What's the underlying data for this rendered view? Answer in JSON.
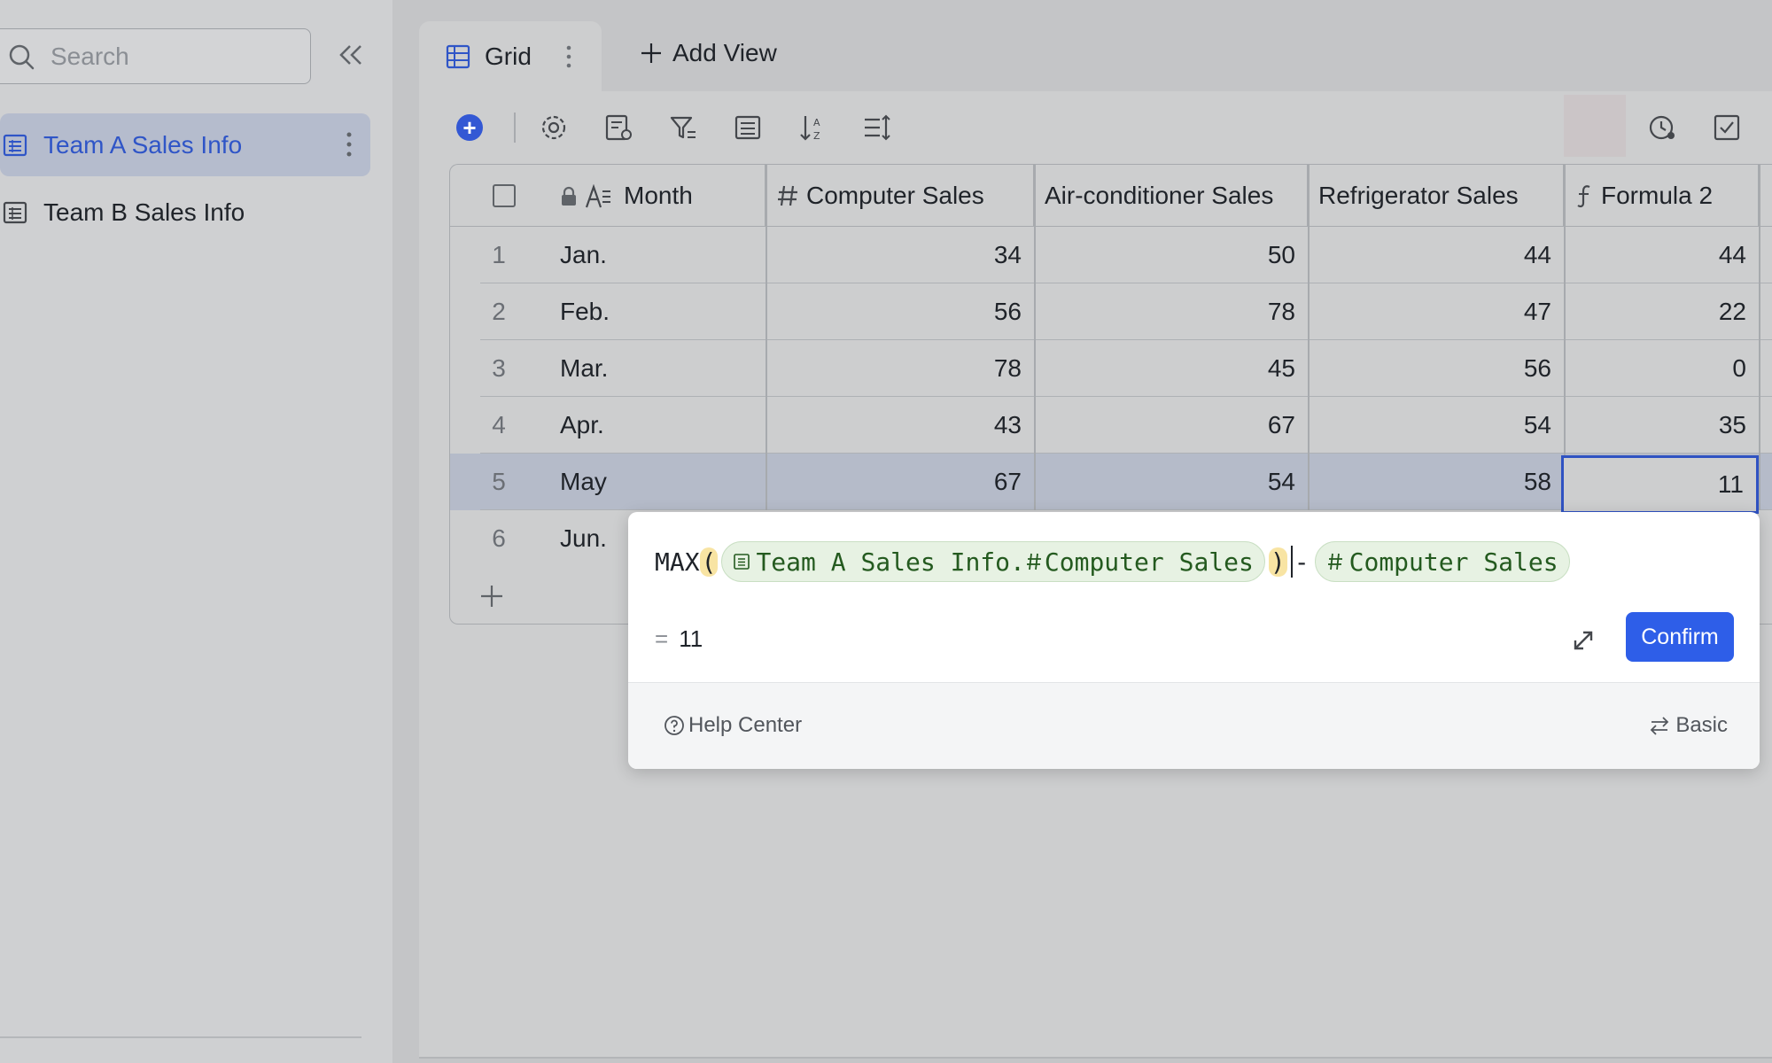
{
  "sidebar": {
    "search_placeholder": "Search",
    "items": [
      {
        "label": "Team A Sales Info",
        "active": true
      },
      {
        "label": "Team B Sales Info",
        "active": false
      }
    ]
  },
  "tabs": {
    "grid_label": "Grid",
    "add_view_label": "Add View"
  },
  "table": {
    "headers": [
      "Month",
      "Computer Sales",
      "Air-conditioner Sales",
      "Refrigerator Sales",
      "Formula 2"
    ],
    "rows": [
      {
        "num": "1",
        "month": "Jan.",
        "computer": "34",
        "ac": "50",
        "fridge": "44",
        "formula": "44"
      },
      {
        "num": "2",
        "month": "Feb.",
        "computer": "56",
        "ac": "78",
        "fridge": "47",
        "formula": "22"
      },
      {
        "num": "3",
        "month": "Mar.",
        "computer": "78",
        "ac": "45",
        "fridge": "56",
        "formula": "0"
      },
      {
        "num": "4",
        "month": "Apr.",
        "computer": "43",
        "ac": "67",
        "fridge": "54",
        "formula": "35"
      },
      {
        "num": "5",
        "month": "May",
        "computer": "67",
        "ac": "54",
        "fridge": "58",
        "formula": "11"
      },
      {
        "num": "6",
        "month": "Jun."
      }
    ]
  },
  "formula_editor": {
    "func": "MAX",
    "open_paren": "(",
    "ref1_table": "Team A Sales Info.",
    "ref1_field": "Computer Sales",
    "close_paren": ")",
    "operator": "-",
    "ref2_field": "Computer Sales",
    "result_eq": "=",
    "result_value": "11",
    "confirm_label": "Confirm",
    "help_label": "Help Center",
    "mode_label": "Basic"
  },
  "colors": {
    "accent": "#2e5ee8",
    "selected_row": "#b5bbc9",
    "active_nav": "#b5bccd",
    "chip_bg": "#e7f2e3"
  }
}
